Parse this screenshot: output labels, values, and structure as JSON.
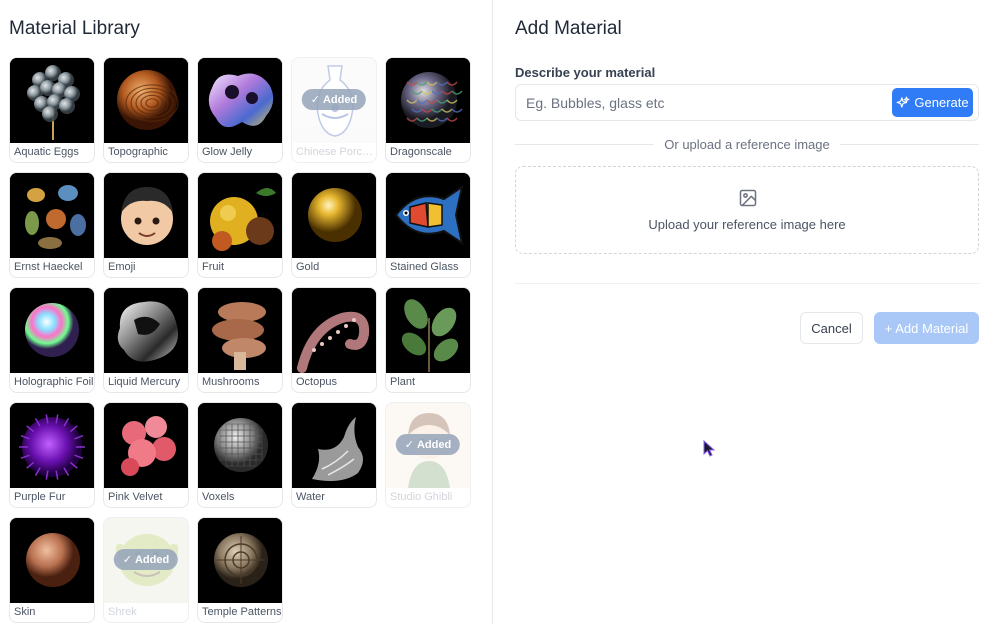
{
  "library": {
    "title": "Material Library",
    "added_badge": "Added",
    "items": [
      {
        "name": "Aquatic Eggs",
        "added": false,
        "icon": "aquatic-eggs-thumb"
      },
      {
        "name": "Topographic",
        "added": false,
        "icon": "topographic-thumb"
      },
      {
        "name": "Glow Jelly",
        "added": false,
        "icon": "glow-jelly-thumb"
      },
      {
        "name": "Chinese Porcelain",
        "added": true,
        "icon": "chinese-porcelain-thumb"
      },
      {
        "name": "Dragonscale",
        "added": false,
        "icon": "dragonscale-thumb"
      },
      {
        "name": "Ernst Haeckel",
        "added": false,
        "icon": "ernst-haeckel-thumb"
      },
      {
        "name": "Emoji",
        "added": false,
        "icon": "emoji-thumb"
      },
      {
        "name": "Fruit",
        "added": false,
        "icon": "fruit-thumb"
      },
      {
        "name": "Gold",
        "added": false,
        "icon": "gold-thumb"
      },
      {
        "name": "Stained Glass",
        "added": false,
        "icon": "stained-glass-thumb"
      },
      {
        "name": "Holographic Foil",
        "added": false,
        "icon": "holographic-foil-thumb"
      },
      {
        "name": "Liquid Mercury",
        "added": false,
        "icon": "liquid-mercury-thumb"
      },
      {
        "name": "Mushrooms",
        "added": false,
        "icon": "mushrooms-thumb"
      },
      {
        "name": "Octopus",
        "added": false,
        "icon": "octopus-thumb"
      },
      {
        "name": "Plant",
        "added": false,
        "icon": "plant-thumb"
      },
      {
        "name": "Purple Fur",
        "added": false,
        "icon": "purple-fur-thumb"
      },
      {
        "name": "Pink Velvet",
        "added": false,
        "icon": "pink-velvet-thumb"
      },
      {
        "name": "Voxels",
        "added": false,
        "icon": "voxels-thumb"
      },
      {
        "name": "Water",
        "added": false,
        "icon": "water-thumb"
      },
      {
        "name": "Studio Ghibli",
        "added": true,
        "icon": "studio-ghibli-thumb"
      },
      {
        "name": "Skin",
        "added": false,
        "icon": "skin-thumb"
      },
      {
        "name": "Shrek",
        "added": true,
        "icon": "shrek-thumb"
      },
      {
        "name": "Temple Patterns",
        "added": false,
        "icon": "temple-patterns-thumb"
      }
    ]
  },
  "add_material": {
    "title": "Add Material",
    "describe_label": "Describe your material",
    "describe_placeholder": "Eg. Bubbles, glass etc",
    "describe_value": "",
    "generate_label": "Generate",
    "or_text": "Or upload a reference image",
    "upload_text": "Upload your reference image here",
    "cancel_label": "Cancel",
    "add_label": "+ Add Material"
  },
  "colors": {
    "accent": "#2f7cf6",
    "accent_disabled": "#a9c8f7",
    "border": "#e5e7eb"
  }
}
